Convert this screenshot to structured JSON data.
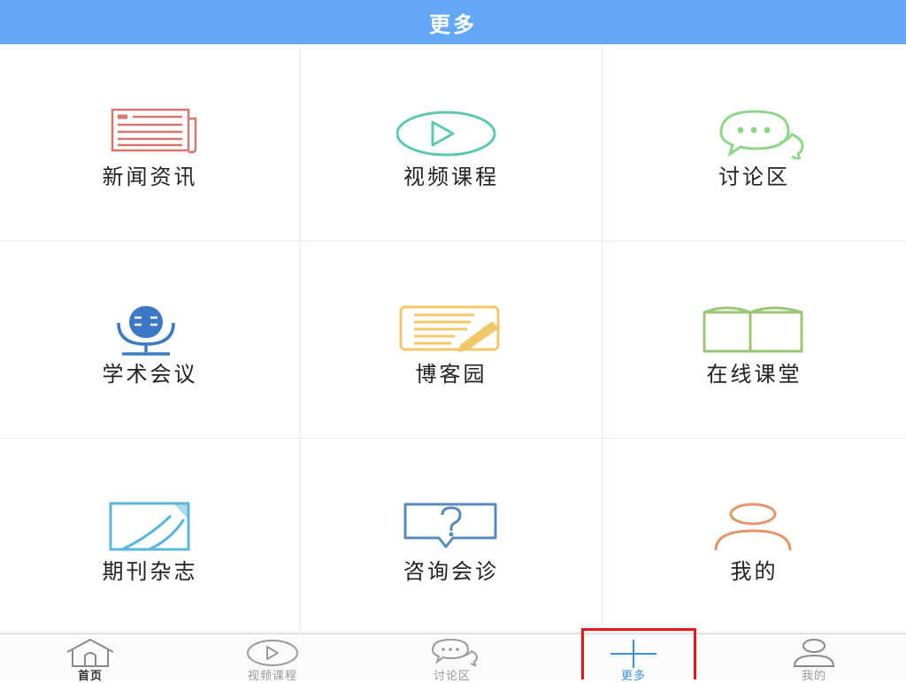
{
  "header": {
    "title": "更多"
  },
  "grid": {
    "items": [
      {
        "label": "新闻资讯",
        "icon": "newspaper-icon",
        "color": "#d9766f"
      },
      {
        "label": "视频课程",
        "icon": "play-circle-icon",
        "color": "#5ec7b4"
      },
      {
        "label": "讨论区",
        "icon": "chat-bubbles-icon",
        "color": "#8fd68a"
      },
      {
        "label": "学术会议",
        "icon": "microphone-icon",
        "color": "#3d78c7"
      },
      {
        "label": "博客园",
        "icon": "notepad-pencil-icon",
        "color": "#f0c86a"
      },
      {
        "label": "在线课堂",
        "icon": "open-book-icon",
        "color": "#9bc673"
      },
      {
        "label": "期刊杂志",
        "icon": "magazine-icon",
        "color": "#5ab7db"
      },
      {
        "label": "咨询会诊",
        "icon": "question-bubble-icon",
        "color": "#5b89b9"
      },
      {
        "label": "我的",
        "icon": "person-icon",
        "color": "#e4956a"
      }
    ]
  },
  "tabbar": {
    "items": [
      {
        "label": "首页",
        "icon": "home-icon"
      },
      {
        "label": "视频课程",
        "icon": "play-circle-icon"
      },
      {
        "label": "讨论区",
        "icon": "chat-bubbles-icon"
      },
      {
        "label": "更多",
        "icon": "plus-icon"
      },
      {
        "label": "我的",
        "icon": "person-icon"
      }
    ],
    "active_color": "#3d8fe8",
    "inactive_color": "#9a9a9a",
    "highlight_color": "#e8151b"
  }
}
